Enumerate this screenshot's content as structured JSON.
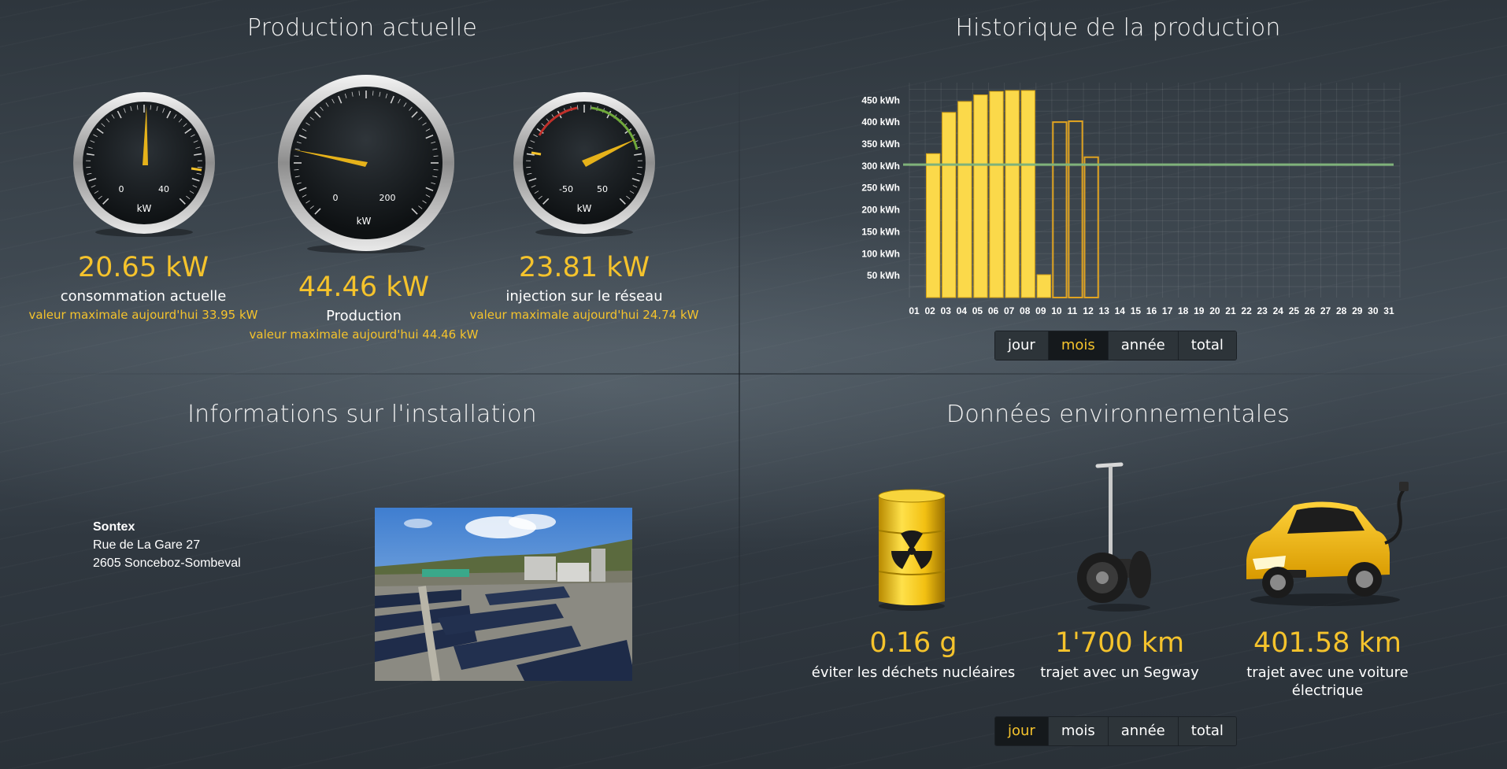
{
  "current_production": {
    "title": "Production actuelle",
    "gauges": [
      {
        "id": "consumption",
        "unit_label": "kW",
        "ticks": [
          "0",
          "40"
        ],
        "value_text": "20.65 kW",
        "label": "consommation actuelle",
        "max_text": "valeur maximale aujourd'hui 33.95 kW"
      },
      {
        "id": "production",
        "unit_label": "kW",
        "ticks": [
          "0",
          "200"
        ],
        "value_text": "44.46 kW",
        "label": "Production",
        "max_text": "valeur maximale aujourd'hui 44.46 kW"
      },
      {
        "id": "injection",
        "unit_label": "kW",
        "ticks": [
          "-50",
          "50"
        ],
        "value_text": "23.81 kW",
        "label": "injection sur le réseau",
        "max_text": "valeur maximale aujourd'hui 24.74 kW"
      }
    ]
  },
  "history": {
    "title": "Historique de la production",
    "tabs": [
      {
        "label": "jour",
        "active": false
      },
      {
        "label": "mois",
        "active": true
      },
      {
        "label": "année",
        "active": false
      },
      {
        "label": "total",
        "active": false
      }
    ]
  },
  "installation": {
    "title": "Informations sur l'installation",
    "org": "Sontex",
    "street": "Rue de La Gare 27",
    "city": "2605 Sonceboz-Sombeval"
  },
  "environment": {
    "title": "Données environnementales",
    "items": [
      {
        "icon": "radioactive-barrel-icon",
        "value": "0.16 g",
        "label": "éviter les déchets nucléaires"
      },
      {
        "icon": "segway-icon",
        "value": "1'700 km",
        "label": "trajet avec un Segway"
      },
      {
        "icon": "electric-car-icon",
        "value": "401.58 km",
        "label": "trajet avec une voiture électrique"
      }
    ],
    "tabs": [
      {
        "label": "jour",
        "active": true
      },
      {
        "label": "mois",
        "active": false
      },
      {
        "label": "année",
        "active": false
      },
      {
        "label": "total",
        "active": false
      }
    ]
  },
  "colors": {
    "accent": "#f5c32c",
    "target_line": "#7fb27a",
    "bar_fill": "#fbd94a",
    "bar_outline": "#e0a320"
  },
  "chart_data": {
    "type": "bar",
    "categories": [
      "01",
      "02",
      "03",
      "04",
      "05",
      "06",
      "07",
      "08",
      "09",
      "10",
      "11",
      "12",
      "13",
      "14",
      "15",
      "16",
      "17",
      "18",
      "19",
      "20",
      "21",
      "22",
      "23",
      "24",
      "25",
      "26",
      "27",
      "28",
      "29",
      "30",
      "31"
    ],
    "series": [
      {
        "style": "filled",
        "values": [
          null,
          328,
          422,
          447,
          462,
          470,
          472,
          472,
          52,
          null,
          null,
          null,
          null,
          null,
          null,
          null,
          null,
          null,
          null,
          null,
          null,
          null,
          null,
          null,
          null,
          null,
          null,
          null,
          null,
          null,
          null
        ]
      },
      {
        "style": "outlined",
        "values": [
          null,
          null,
          null,
          null,
          null,
          null,
          null,
          null,
          null,
          400,
          402,
          320,
          null,
          null,
          null,
          null,
          null,
          null,
          null,
          null,
          null,
          null,
          null,
          null,
          null,
          null,
          null,
          null,
          null,
          null,
          null
        ]
      }
    ],
    "reference_line": 303,
    "y_ticks": [
      "50 kWh",
      "100 kWh",
      "150 kWh",
      "200 kWh",
      "250 kWh",
      "300 kWh",
      "350 kWh",
      "400 kWh",
      "450 kWh"
    ],
    "ylim": [
      0,
      490
    ],
    "grid": true
  }
}
